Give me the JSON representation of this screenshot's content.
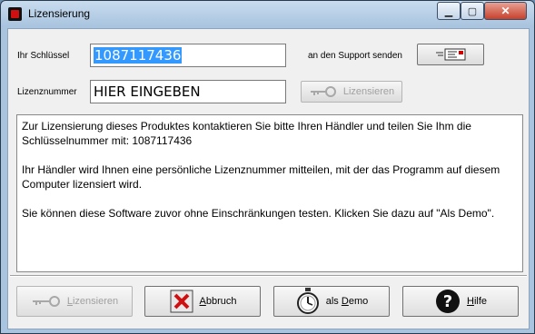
{
  "window": {
    "title": "Lizensierung"
  },
  "key_row": {
    "label": "Ihr Schlüssel",
    "value": "1087117436",
    "support_label": "an den Support senden"
  },
  "license_row": {
    "label": "Lizenznummer",
    "value": "HIER EINGEBEN",
    "button": "Lizensieren"
  },
  "info": {
    "p1": "Zur Lizensierung dieses Produktes kontaktieren Sie bitte Ihren Händler und teilen Sie Ihm die Schlüsselnummer mit: 1087117436",
    "p2": "Ihr Händler wird Ihnen eine persönliche Lizenznummer mitteilen, mit der das Programm auf diesem Computer lizensiert wird.",
    "p3": "Sie können diese Software zuvor ohne Einschränkungen testen. Klicken Sie dazu auf \"Als Demo\"."
  },
  "buttons": {
    "license_first": "L",
    "license_rest": "izensieren",
    "cancel_first": "A",
    "cancel_rest": "bbruch",
    "demo_prefix": "als ",
    "demo_first": "D",
    "demo_rest": "emo",
    "help_first": "H",
    "help_rest": "ilfe"
  },
  "icons": {
    "app": "app-icon",
    "key": "key-icon",
    "mail": "mail-icon",
    "cancel": "red-x-icon",
    "watch": "stopwatch-icon",
    "help": "question-icon"
  }
}
